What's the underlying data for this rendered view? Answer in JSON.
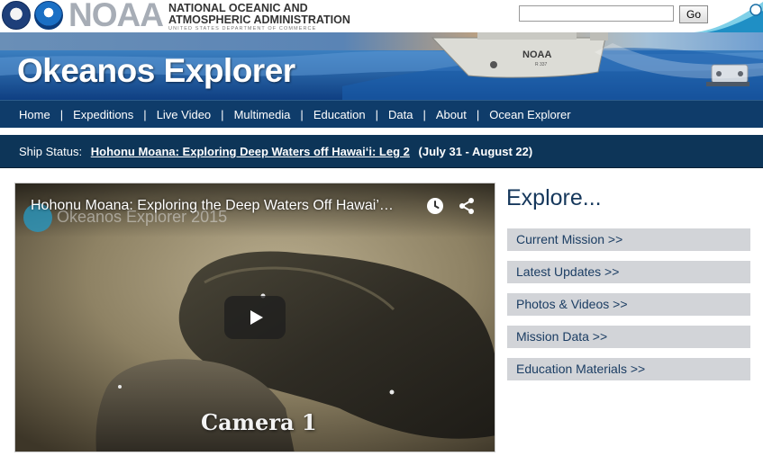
{
  "header": {
    "agency_wordmark": "NOAA",
    "agency_name_line1": "NATIONAL OCEANIC AND",
    "agency_name_line2": "ATMOSPHERIC ADMINISTRATION",
    "agency_dept": "UNITED STATES DEPARTMENT OF COMMERCE",
    "seal_left_icon": "commerce-seal-icon",
    "seal_right_icon": "noaa-seal-icon"
  },
  "search": {
    "value": "",
    "placeholder": "",
    "button_label": "Go"
  },
  "banner": {
    "title": "Okeanos Explorer",
    "ship_marking": "NOAA",
    "ship_hull_number": "R 337"
  },
  "nav": {
    "items": [
      {
        "label": "Home"
      },
      {
        "label": "Expeditions"
      },
      {
        "label": "Live Video"
      },
      {
        "label": "Multimedia"
      },
      {
        "label": "Education"
      },
      {
        "label": "Data"
      },
      {
        "label": "About"
      },
      {
        "label": "Ocean Explorer"
      }
    ],
    "separator": "|"
  },
  "status": {
    "label": "Ship Status:",
    "mission_link": "Hohonu Moana: Exploring Deep Waters off Hawai‘i: Leg 2",
    "dates": "(July 31 - August 22)"
  },
  "video": {
    "title": "Hohonu Moana: Exploring the Deep Waters Off Hawai’…",
    "watermark": "Okeanos Explorer 2015",
    "camera_label": "Camera 1",
    "icons": [
      "play-icon",
      "clock-icon",
      "share-icon"
    ]
  },
  "explore": {
    "heading": "Explore...",
    "links": [
      {
        "label": "Current Mission >>"
      },
      {
        "label": "Latest Updates >>"
      },
      {
        "label": "Photos & Videos >>"
      },
      {
        "label": "Mission Data >>"
      },
      {
        "label": "Education Materials >>"
      }
    ]
  },
  "colors": {
    "nav_bg": "#0f3c6a",
    "status_bg": "#0d3558",
    "explore_button_bg": "#d2d4d8",
    "explore_text": "#1b3d63"
  }
}
